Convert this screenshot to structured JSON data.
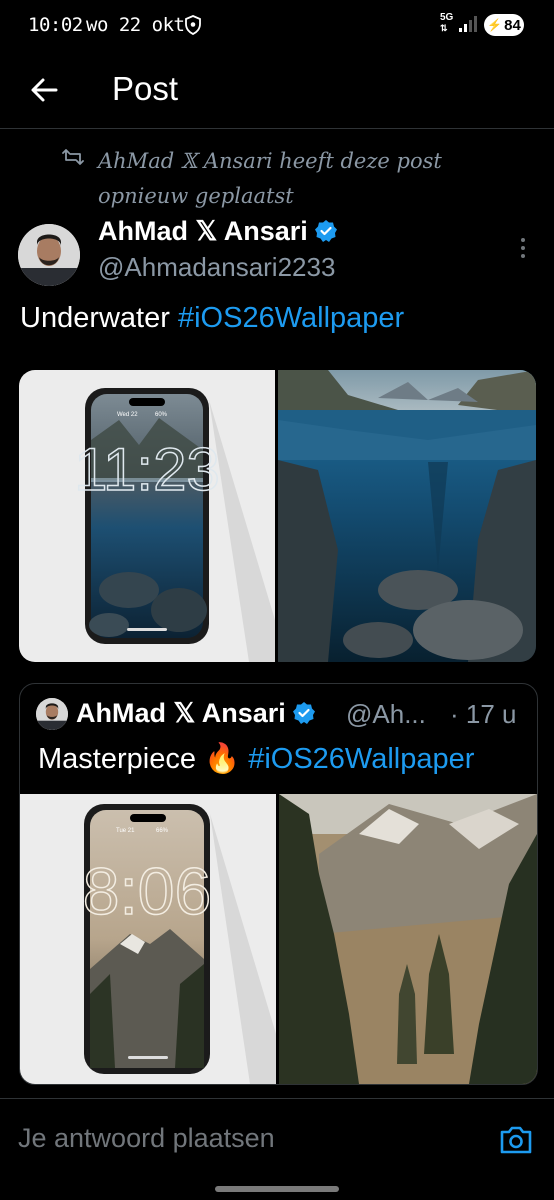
{
  "status_bar": {
    "time": "10:02",
    "date": "wo 22 okt",
    "network": "5G",
    "battery": "84",
    "icons": [
      "shield-icon",
      "signal-icon",
      "battery-icon"
    ]
  },
  "header": {
    "back_icon": "arrow-left-icon",
    "title": "Post"
  },
  "repost": {
    "icon": "repost-icon",
    "text": "AhMad 𝕏 Ansari heeft deze post opnieuw geplaatst"
  },
  "post": {
    "author_name": "AhMad 𝕏 Ansari",
    "verified_icon": "verified-badge-icon",
    "handle": "@Ahmadansari2233",
    "text_plain": "Underwater ",
    "hashtag": "#iOS26Wallpaper",
    "more_icon": "more-vertical-icon",
    "media": {
      "phone_date": "Wed 22",
      "phone_battery": "60%",
      "phone_time": "11:23"
    }
  },
  "quote": {
    "author_name": "AhMad 𝕏 Ansari",
    "handle": "@Ah...",
    "time": "· 17 u",
    "text_plain": "Masterpiece 🔥 ",
    "hashtag": "#iOS26Wallpaper",
    "media": {
      "phone_date": "Tue 21",
      "phone_battery": "66%",
      "phone_time": "8:06"
    }
  },
  "reply": {
    "placeholder": "Je antwoord plaatsen",
    "camera_icon": "camera-icon"
  },
  "colors": {
    "background": "#000000",
    "accent": "#1d9bf0",
    "secondary_text": "#8b98a5",
    "divider": "#2f3336"
  }
}
